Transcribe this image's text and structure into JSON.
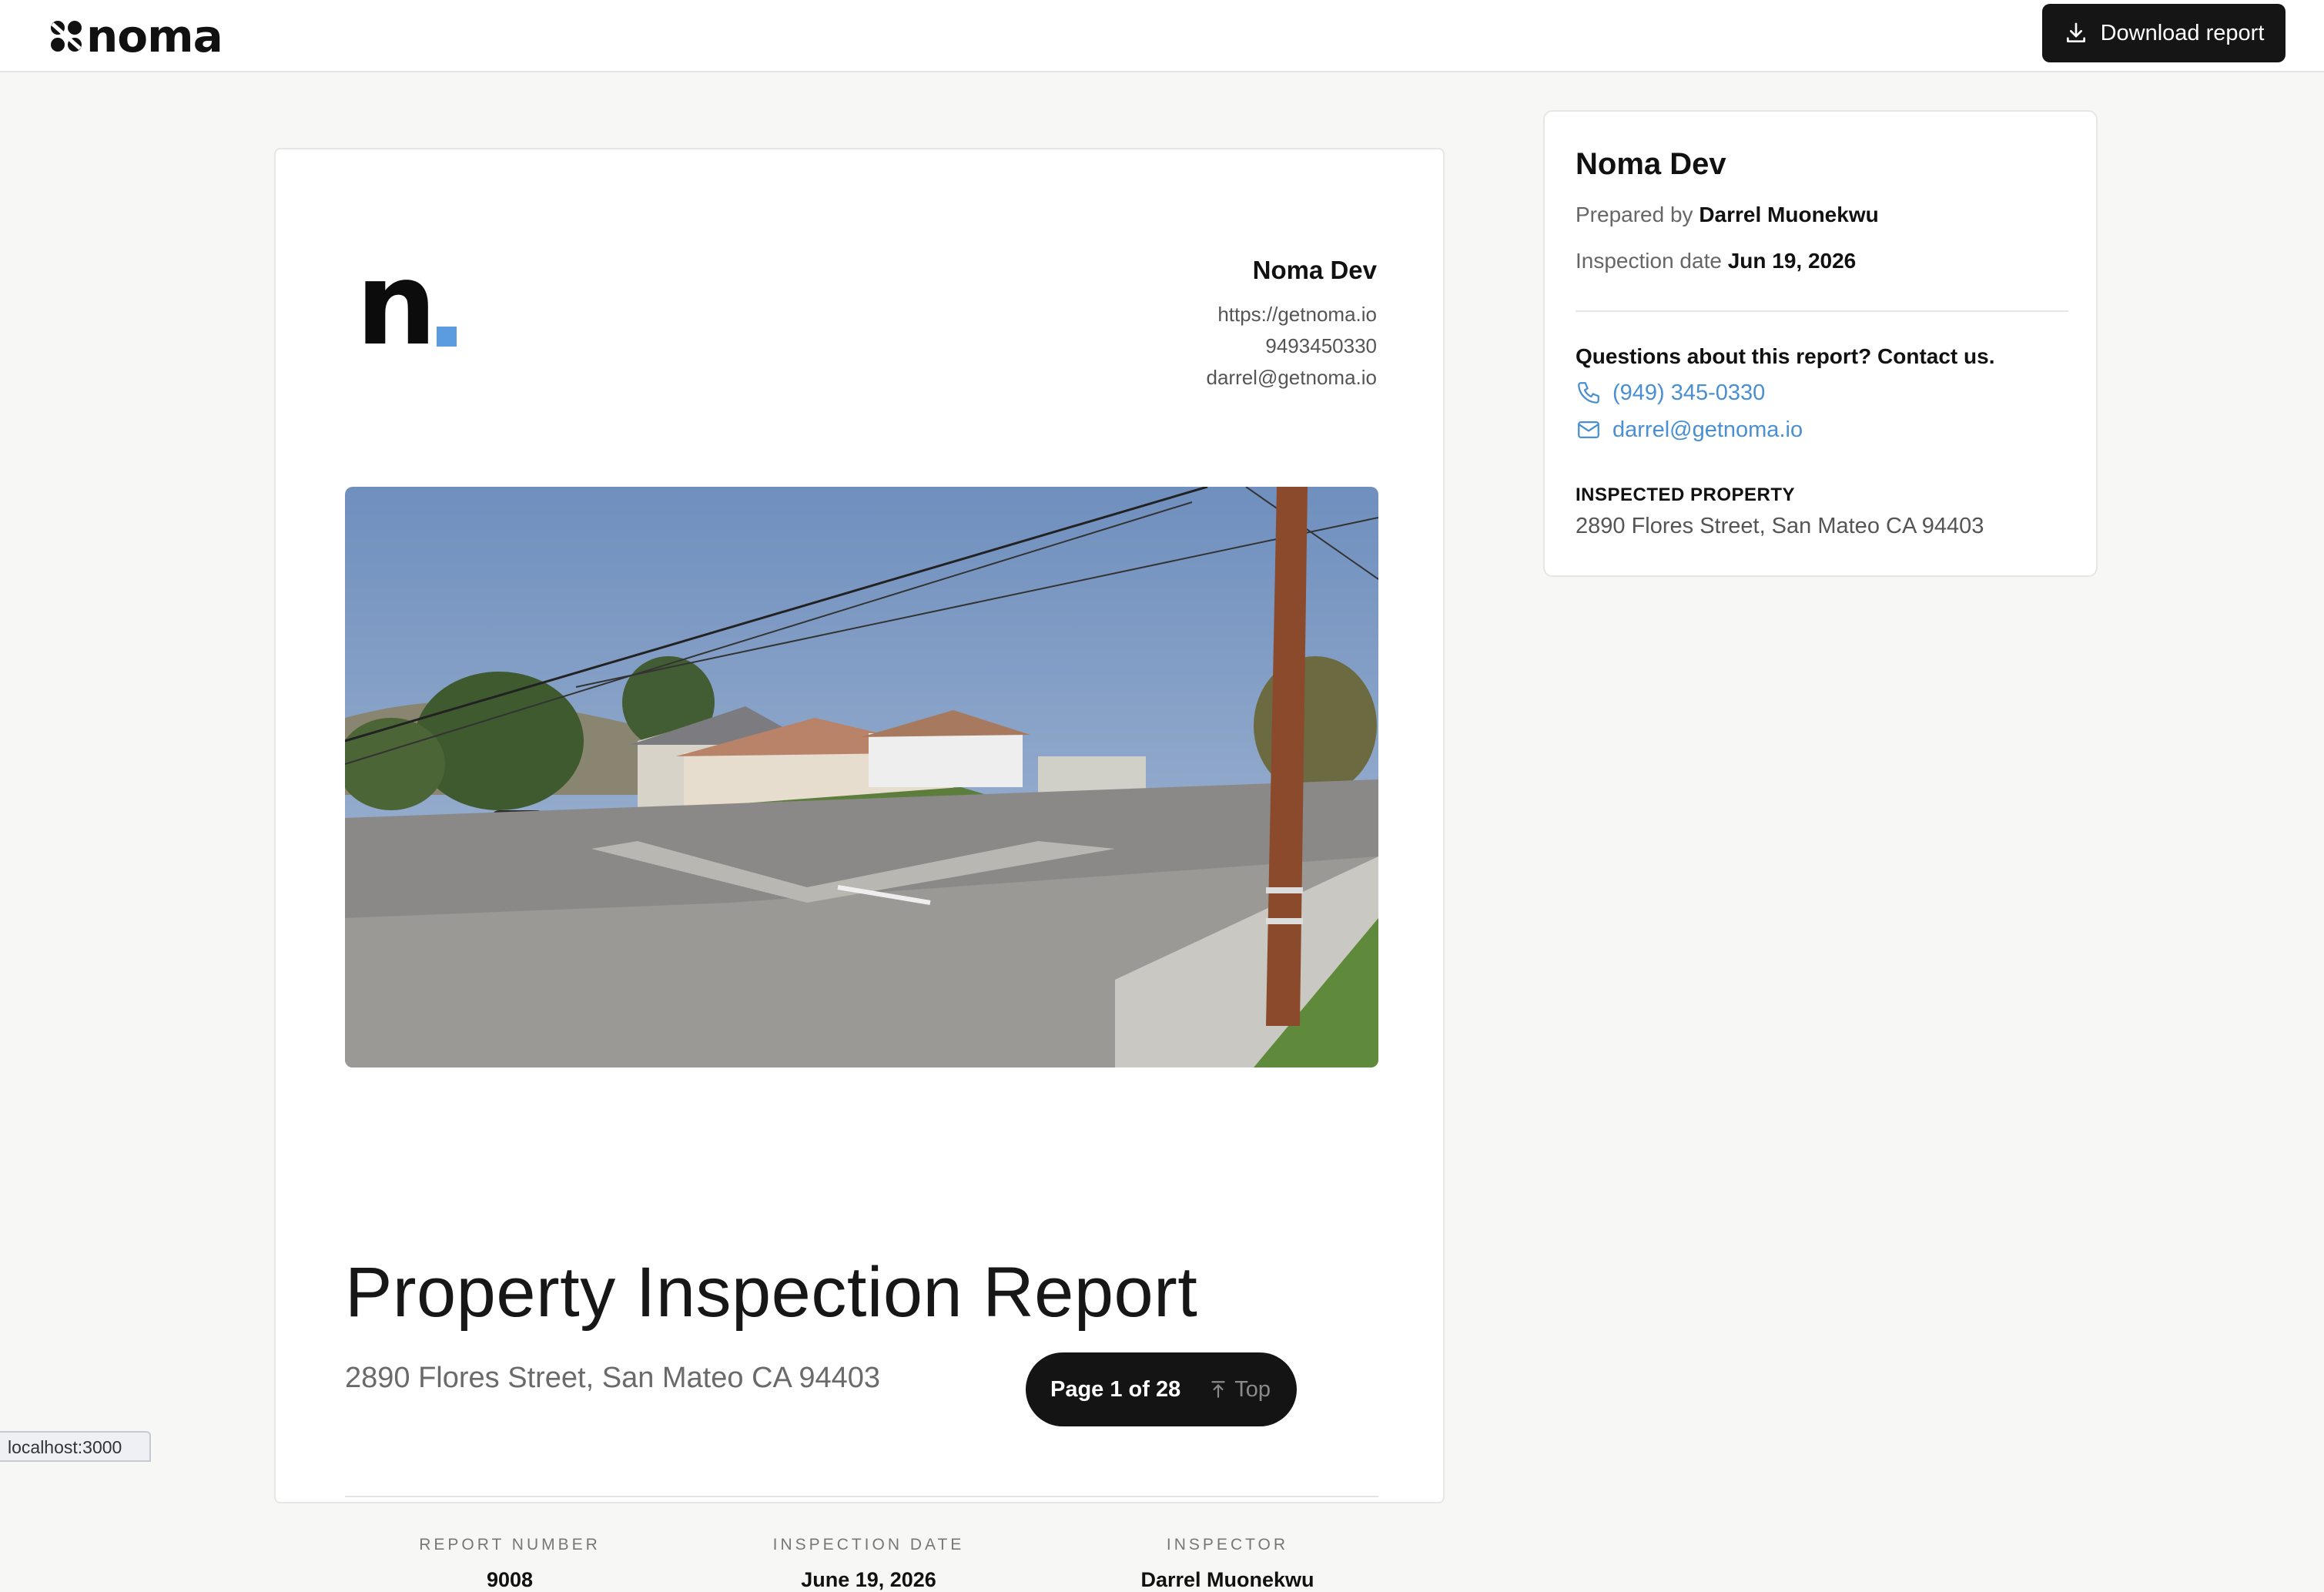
{
  "app": {
    "brand": "noma"
  },
  "header": {
    "download_label": "Download report"
  },
  "document": {
    "company_name": "Noma Dev",
    "website": "https://getnoma.io",
    "phone": "9493450330",
    "email": "darrel@getnoma.io",
    "title": "Property Inspection Report",
    "address": "2890 Flores Street, San Mateo CA 94403",
    "meta": [
      {
        "label": "REPORT NUMBER",
        "value": "9008"
      },
      {
        "label": "INSPECTION DATE",
        "value": "June 19, 2026"
      },
      {
        "label": "INSPECTOR",
        "value": "Darrel Muonekwu"
      }
    ]
  },
  "pager": {
    "text": "Page 1 of 28",
    "top_label": "Top"
  },
  "sidebar": {
    "company_name": "Noma Dev",
    "prepared_label": "Prepared by",
    "prepared_by": "Darrel Muonekwu",
    "date_label": "Inspection date",
    "date": "Jun 19, 2026",
    "question": "Questions about this report? Contact us.",
    "phone": "(949) 345-0330",
    "email": "darrel@getnoma.io",
    "property_label": "INSPECTED PROPERTY",
    "property_address": "2890 Flores Street, San Mateo CA 94403"
  },
  "status_bar": {
    "url": "localhost:3000"
  },
  "colors": {
    "accent_link": "#4a8fd1",
    "logo_dot": "#5b9be0",
    "dark_button": "#151515"
  }
}
